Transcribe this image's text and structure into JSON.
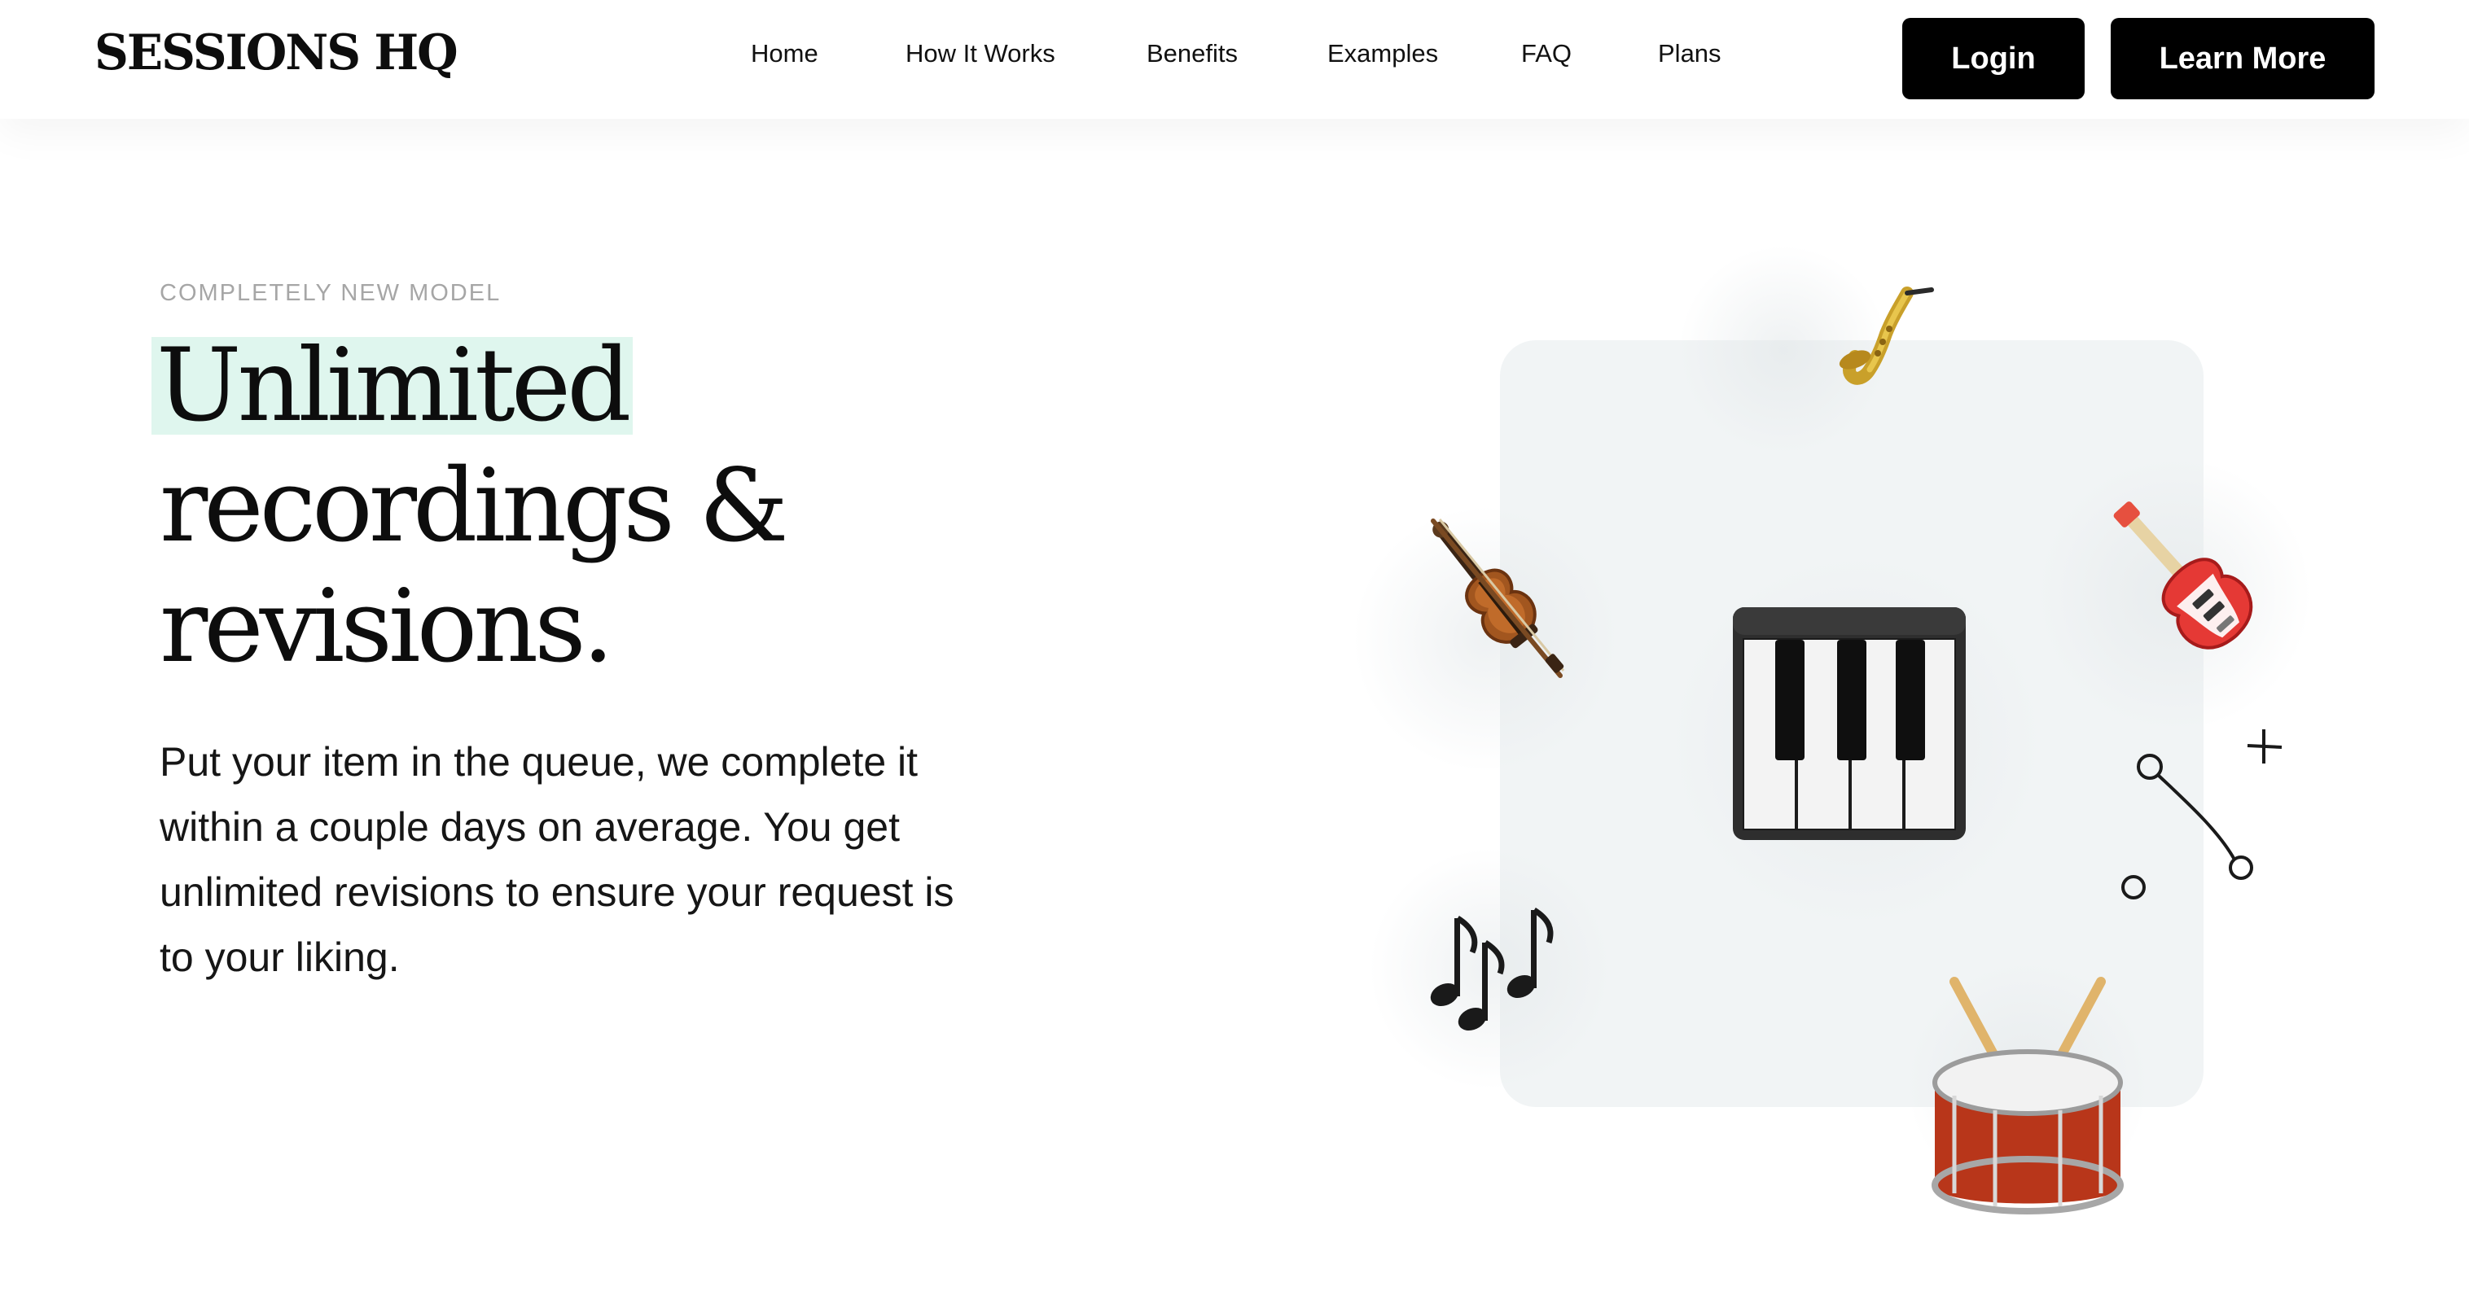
{
  "header": {
    "logo": "SESSIONS HQ",
    "nav": [
      "Home",
      "How It Works",
      "Benefits",
      "Examples",
      "FAQ",
      "Plans"
    ],
    "login_label": "Login",
    "learn_more_label": "Learn More"
  },
  "hero": {
    "eyebrow": "COMPLETELY NEW MODEL",
    "headline_highlight": "Unlimited",
    "headline_line2": "recordings &",
    "headline_line3": "revisions.",
    "subtext": "Put your item in the queue, we complete it within a couple days on average. You get unlimited revisions to ensure your request is to your liking."
  },
  "illustration": {
    "icons": [
      "saxophone-icon",
      "violin-icon",
      "guitar-icon",
      "piano-keys-icon",
      "music-notes-icon",
      "drum-icon"
    ]
  },
  "colors": {
    "highlight": "#dff6ee",
    "button": "#000000",
    "panel": "#f1f4f5",
    "eyebrow": "#a6a6a6"
  }
}
